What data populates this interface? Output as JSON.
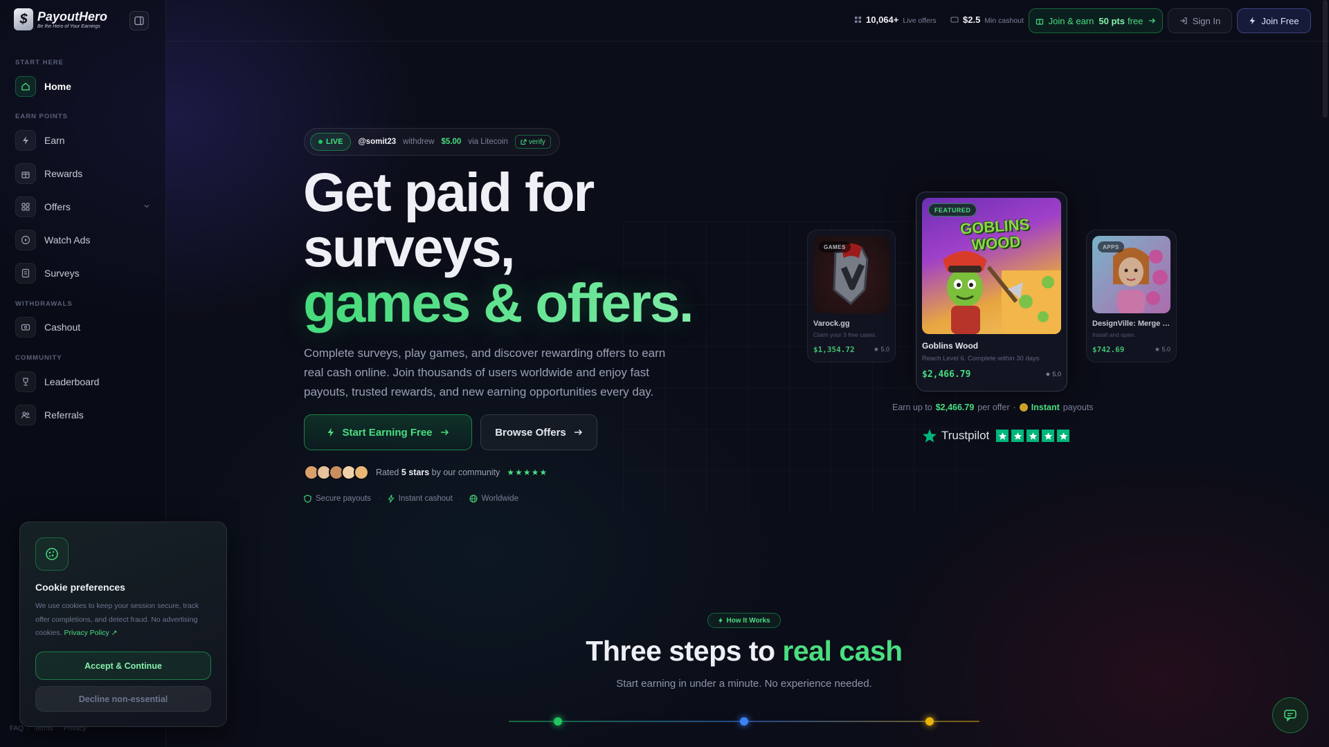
{
  "brand": {
    "name": "PayoutHero",
    "tagline": "Be the Hero of Your Earnings",
    "mark": "$"
  },
  "sidebar": {
    "sections": [
      {
        "label": "START HERE"
      },
      {
        "label": "EARN POINTS"
      },
      {
        "label": "WITHDRAWALS"
      },
      {
        "label": "COMMUNITY"
      }
    ],
    "items": [
      {
        "label": "Home",
        "icon": "home-icon",
        "active": true
      },
      {
        "label": "Earn",
        "icon": "bolt-icon"
      },
      {
        "label": "Rewards",
        "icon": "gift-icon"
      },
      {
        "label": "Offers",
        "icon": "grid-icon"
      },
      {
        "label": "Watch Ads",
        "icon": "play-icon"
      },
      {
        "label": "Surveys",
        "icon": "survey-icon"
      },
      {
        "label": "Cashout",
        "icon": "wallet-icon"
      },
      {
        "label": "Leaderboard",
        "icon": "trophy-icon"
      },
      {
        "label": "Referrals",
        "icon": "users-icon"
      }
    ],
    "footer": {
      "faq": "FAQ",
      "terms": "Terms",
      "privacy": "Privacy",
      "sep": "·"
    }
  },
  "topbar": {
    "live_offers_value": "10,064+",
    "live_offers_label": "Live offers",
    "min_cashout_value": "$2.5",
    "min_cashout_label": "Min cashout",
    "join_earn_prefix": "Join & earn",
    "join_earn_points": "50 pts",
    "join_earn_suffix": "free",
    "sign_in": "Sign In",
    "join_free": "Join Free"
  },
  "live": {
    "badge": "LIVE",
    "user": "@somit23",
    "action": "withdrew",
    "amount": "$5.00",
    "method": "via Litecoin",
    "verify": "verify"
  },
  "hero": {
    "line1": "Get paid for",
    "line2": "surveys,",
    "line3": "games & offers.",
    "subtext": "Complete surveys, play games, and discover rewarding offers to earn real cash online. Join thousands of users worldwide and enjoy fast payouts, trusted rewards, and new earning opportunities every day.",
    "cta_primary": "Start Earning Free",
    "cta_secondary": "Browse Offers",
    "rated_prefix": "Rated",
    "rated_value": "5 stars",
    "rated_suffix": "by our community",
    "stars": "★★★★★",
    "trust": [
      "Secure payouts",
      "Instant cashout",
      "Worldwide"
    ],
    "trust_sep": "·"
  },
  "cards": {
    "left": {
      "badge": "GAMES",
      "title": "Varock.gg",
      "desc": "Claim your 3 free cases.",
      "price": "$1,354.72",
      "rating": "5.0"
    },
    "center": {
      "badge": "FEATURED",
      "title": "Goblins Wood",
      "art_title": "GOBLINS WOOD",
      "desc": "Reach Level 6. Complete within 30 days.",
      "price": "$2,466.79",
      "rating": "5.0"
    },
    "right": {
      "badge": "APPS",
      "title": "DesignVille: Merge & ...",
      "desc": "Install and open.",
      "price": "$742.69",
      "rating": "5.0"
    }
  },
  "earn_upto": {
    "prefix": "Earn up to",
    "amount": "$2,466.79",
    "middle": "per offer",
    "dot": "·",
    "instant": "Instant",
    "suffix": "payouts"
  },
  "trustpilot": {
    "name": "Trustpilot"
  },
  "how": {
    "badge": "How It Works",
    "title_a": "Three steps to",
    "title_b": "real cash",
    "subtitle": "Start earning in under a minute. No experience needed.",
    "step_colors": [
      "#22c55e",
      "#3b82f6",
      "#eab308"
    ]
  },
  "cookie": {
    "title": "Cookie preferences",
    "text": "We use cookies to keep your session secure, track offer completions, and detect fraud. No advertising cookies.",
    "link": "Privacy Policy ↗",
    "accept": "Accept & Continue",
    "decline": "Decline non-essential"
  },
  "colors": {
    "accent": "#4ade80",
    "background": "#0b0d18",
    "brand_blue": "#3b82f6"
  }
}
